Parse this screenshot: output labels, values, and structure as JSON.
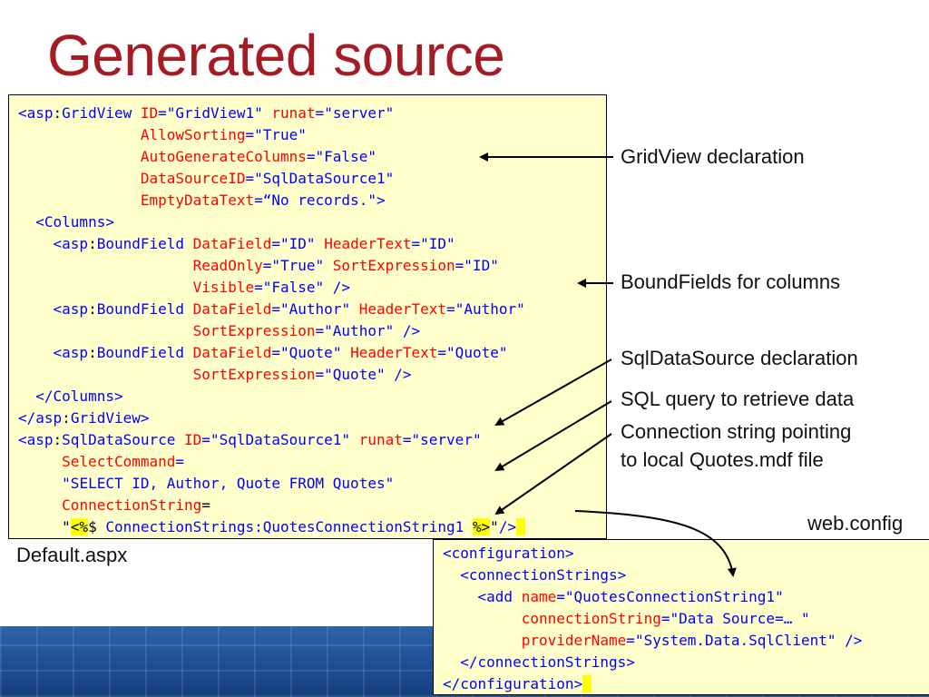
{
  "slide": {
    "title": "Generated source"
  },
  "annotations": {
    "gridview_decl": "GridView declaration",
    "boundfields": "BoundFields for columns",
    "sqldatasource_decl": "SqlDataSource declaration",
    "sql_query": "SQL query to retrieve data",
    "conn_line1": "Connection string pointing",
    "conn_line2": "to local Quotes.mdf file"
  },
  "files": {
    "default": "Default.aspx",
    "webconfig": "web.config"
  },
  "default_aspx_code": [
    [
      [
        "tag",
        "<asp"
      ],
      [
        "txt",
        ":"
      ],
      [
        "tag",
        "GridView "
      ],
      [
        "attr",
        "ID"
      ],
      [
        "tag",
        "="
      ],
      [
        "val",
        "\"GridView1\" "
      ],
      [
        "attr",
        "runat"
      ],
      [
        "tag",
        "="
      ],
      [
        "val",
        "\"server\""
      ]
    ],
    [
      [
        "txt",
        "              "
      ],
      [
        "attr",
        "AllowSorting"
      ],
      [
        "tag",
        "="
      ],
      [
        "val",
        "\"True\""
      ]
    ],
    [
      [
        "txt",
        "              "
      ],
      [
        "attr",
        "AutoGenerateColumns"
      ],
      [
        "tag",
        "="
      ],
      [
        "val",
        "\"False\""
      ]
    ],
    [
      [
        "txt",
        "              "
      ],
      [
        "attr",
        "DataSourceID"
      ],
      [
        "tag",
        "="
      ],
      [
        "val",
        "\"SqlDataSource1\""
      ]
    ],
    [
      [
        "txt",
        "              "
      ],
      [
        "attr",
        "EmptyDataText"
      ],
      [
        "tag",
        "="
      ],
      [
        "val",
        "“No records.\">"
      ]
    ],
    [
      [
        "txt",
        "  "
      ],
      [
        "tag",
        "<Columns>"
      ]
    ],
    [
      [
        "txt",
        "    "
      ],
      [
        "tag",
        "<asp"
      ],
      [
        "txt",
        ":"
      ],
      [
        "tag",
        "BoundField "
      ],
      [
        "attr",
        "DataField"
      ],
      [
        "tag",
        "="
      ],
      [
        "val",
        "\"ID\" "
      ],
      [
        "attr",
        "HeaderText"
      ],
      [
        "tag",
        "="
      ],
      [
        "val",
        "\"ID\""
      ]
    ],
    [
      [
        "txt",
        "                    "
      ],
      [
        "attr",
        "ReadOnly"
      ],
      [
        "tag",
        "="
      ],
      [
        "val",
        "\"True\" "
      ],
      [
        "attr",
        "SortExpression"
      ],
      [
        "tag",
        "="
      ],
      [
        "val",
        "\"ID\""
      ]
    ],
    [
      [
        "txt",
        "                    "
      ],
      [
        "attr",
        "Visible"
      ],
      [
        "tag",
        "="
      ],
      [
        "val",
        "\"False\" />"
      ]
    ],
    [
      [
        "txt",
        "    "
      ],
      [
        "tag",
        "<asp"
      ],
      [
        "txt",
        ":"
      ],
      [
        "tag",
        "BoundField "
      ],
      [
        "attr",
        "DataField"
      ],
      [
        "tag",
        "="
      ],
      [
        "val",
        "\"Author\" "
      ],
      [
        "attr",
        "HeaderText"
      ],
      [
        "tag",
        "="
      ],
      [
        "val",
        "\"Author\""
      ]
    ],
    [
      [
        "txt",
        "                    "
      ],
      [
        "attr",
        "SortExpression"
      ],
      [
        "tag",
        "="
      ],
      [
        "val",
        "\"Author\" />"
      ]
    ],
    [
      [
        "txt",
        "    "
      ],
      [
        "tag",
        "<asp"
      ],
      [
        "txt",
        ":"
      ],
      [
        "tag",
        "BoundField "
      ],
      [
        "attr",
        "DataField"
      ],
      [
        "tag",
        "="
      ],
      [
        "val",
        "\"Quote\" "
      ],
      [
        "attr",
        "HeaderText"
      ],
      [
        "tag",
        "="
      ],
      [
        "val",
        "\"Quote\""
      ]
    ],
    [
      [
        "txt",
        "                    "
      ],
      [
        "attr",
        "SortExpression"
      ],
      [
        "tag",
        "="
      ],
      [
        "val",
        "\"Quote\" />"
      ]
    ],
    [
      [
        "txt",
        "  "
      ],
      [
        "tag",
        "</Columns>"
      ]
    ],
    [
      [
        "tag",
        "</asp"
      ],
      [
        "txt",
        ":"
      ],
      [
        "tag",
        "GridView>"
      ]
    ],
    [
      [
        "tag",
        "<asp"
      ],
      [
        "txt",
        ":"
      ],
      [
        "tag",
        "SqlDataSource "
      ],
      [
        "attr",
        "ID"
      ],
      [
        "tag",
        "="
      ],
      [
        "val",
        "\"SqlDataSource1\" "
      ],
      [
        "attr",
        "runat"
      ],
      [
        "tag",
        "="
      ],
      [
        "val",
        "\"server\""
      ]
    ],
    [
      [
        "txt",
        "     "
      ],
      [
        "attr",
        "SelectCommand"
      ],
      [
        "tag",
        "="
      ]
    ],
    [
      [
        "txt",
        "     "
      ],
      [
        "val",
        "\"SELECT ID, Author, Quote FROM Quotes\""
      ]
    ],
    [
      [
        "txt",
        "     "
      ],
      [
        "attr",
        "ConnectionString"
      ],
      [
        "txt",
        "="
      ]
    ],
    [
      [
        "txt",
        "     \""
      ],
      [
        "hl",
        "<%"
      ],
      [
        "txt",
        "$ "
      ],
      [
        "val",
        "ConnectionStrings:QuotesConnectionString1 "
      ],
      [
        "hl",
        "%>"
      ],
      [
        "txt",
        "\""
      ],
      [
        "tag",
        "/>"
      ],
      [
        "hl",
        " "
      ]
    ]
  ],
  "web_config_code": [
    [
      [
        "tag",
        "<configuration>"
      ]
    ],
    [
      [
        "txt",
        "  "
      ],
      [
        "tag",
        "<connectionStrings>"
      ]
    ],
    [
      [
        "txt",
        "    "
      ],
      [
        "tag",
        "<add "
      ],
      [
        "attr",
        "name"
      ],
      [
        "tag",
        "="
      ],
      [
        "val",
        "\"QuotesConnectionString1\""
      ]
    ],
    [
      [
        "txt",
        "         "
      ],
      [
        "attr",
        "connectionString"
      ],
      [
        "tag",
        "="
      ],
      [
        "val",
        "\"Data Source=… \""
      ]
    ],
    [
      [
        "txt",
        "         "
      ],
      [
        "attr",
        "providerName"
      ],
      [
        "tag",
        "="
      ],
      [
        "val",
        "\"System.Data.SqlClient\" />"
      ]
    ],
    [
      [
        "txt",
        "  "
      ],
      [
        "tag",
        "</connectionStrings>"
      ]
    ],
    [
      [
        "tag",
        "</configuration>"
      ],
      [
        "hl",
        " "
      ]
    ]
  ],
  "colors": {
    "title": "#a51c24",
    "code_background": "#ffffcc",
    "tag": "#0000ff",
    "attribute": "#ff0000",
    "highlight": "#ffff00"
  }
}
